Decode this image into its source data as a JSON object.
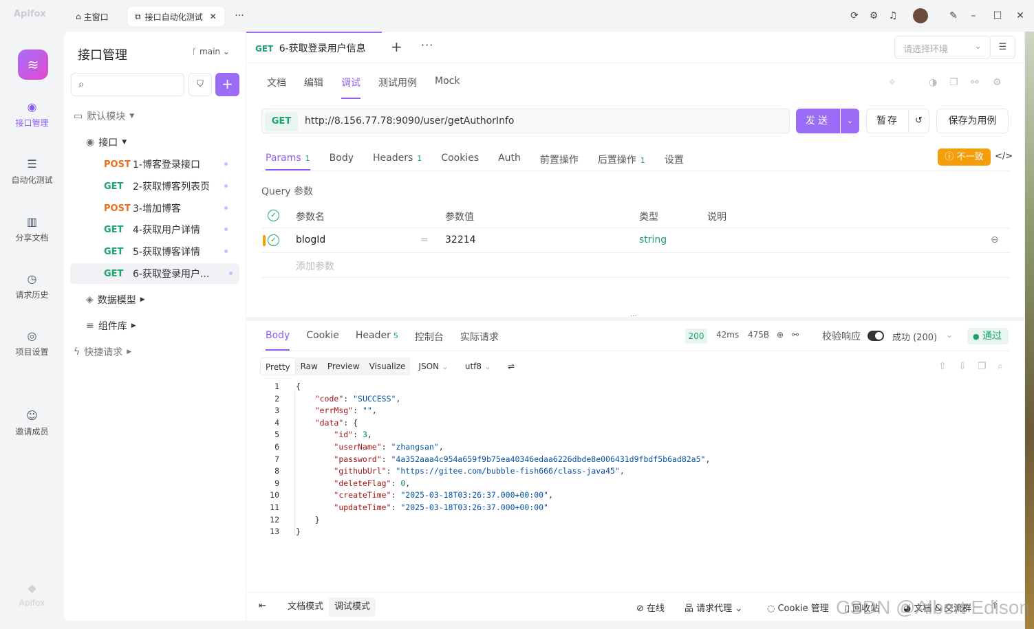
{
  "titlebar": {
    "app_name": "Apifox",
    "tabs": [
      {
        "label": "主窗口"
      },
      {
        "label": "接口自动化测试"
      }
    ],
    "more": "···"
  },
  "rail": {
    "items": [
      {
        "label": "接口管理",
        "icon": "api-icon"
      },
      {
        "label": "自动化测试",
        "icon": "automation-icon"
      },
      {
        "label": "分享文档",
        "icon": "book-icon"
      },
      {
        "label": "请求历史",
        "icon": "clock-icon"
      },
      {
        "label": "项目设置",
        "icon": "settings-icon"
      },
      {
        "label": "邀请成员",
        "icon": "user-add-icon"
      }
    ],
    "bottom_logo": "Apifox"
  },
  "sidebar": {
    "title": "接口管理",
    "branch": "main",
    "default_module": "默认模块",
    "folder": "接口",
    "endpoints": [
      {
        "method": "POST",
        "name": "1-博客登录接口"
      },
      {
        "method": "GET",
        "name": "2-获取博客列表页"
      },
      {
        "method": "POST",
        "name": "3-增加博客"
      },
      {
        "method": "GET",
        "name": "4-获取用户详情"
      },
      {
        "method": "GET",
        "name": "5-获取博客详情"
      },
      {
        "method": "GET",
        "name": "6-获取登录用户..."
      }
    ],
    "data_model": "数据模型",
    "components": "组件库",
    "quick_request": "快捷请求"
  },
  "request_tab": {
    "method": "GET",
    "name": "6-获取登录用户信息"
  },
  "env": {
    "placeholder": "请选择环境"
  },
  "subtabs": [
    "文档",
    "编辑",
    "调试",
    "测试用例",
    "Mock"
  ],
  "url_bar": {
    "method": "GET",
    "url": "http://8.156.77.78:9090/user/getAuthorInfo",
    "send": "发送",
    "save": "暂存",
    "save_case": "保存为用例"
  },
  "param_tabs": [
    {
      "label": "Params",
      "count": "1"
    },
    {
      "label": "Body",
      "count": ""
    },
    {
      "label": "Headers",
      "count": "1"
    },
    {
      "label": "Cookies",
      "count": ""
    },
    {
      "label": "Auth",
      "count": ""
    },
    {
      "label": "前置操作",
      "count": ""
    },
    {
      "label": "后置操作",
      "count": "1"
    },
    {
      "label": "设置",
      "count": ""
    }
  ],
  "diff_badge": "不一致",
  "query": {
    "label": "Query 参数",
    "headers": {
      "name": "参数名",
      "value": "参数值",
      "type": "类型",
      "desc": "说明"
    },
    "row": {
      "name": "blogId",
      "eq": "=",
      "value": "32214",
      "type": "string"
    },
    "add_placeholder": "添加参数"
  },
  "response": {
    "tabs": [
      {
        "label": "Body",
        "count": ""
      },
      {
        "label": "Cookie",
        "count": ""
      },
      {
        "label": "Header",
        "count": "5"
      },
      {
        "label": "控制台",
        "count": ""
      },
      {
        "label": "实际请求",
        "count": ""
      }
    ],
    "status": "200",
    "time": "42ms",
    "size": "475B",
    "validate_label": "校验响应",
    "result": "成功 (200)",
    "pass": "通过",
    "formats": [
      "Pretty",
      "Raw",
      "Preview",
      "Visualize"
    ],
    "lang": "JSON",
    "encoding": "utf8",
    "lines": [
      "{",
      "    \"code\": \"SUCCESS\",",
      "    \"errMsg\": \"\",",
      "    \"data\": {",
      "        \"id\": 3,",
      "        \"userName\": \"zhangsan\",",
      "        \"password\": \"4a352aaa4c954a659f9b75ea40346edaa6226dbde8e006431d9fbdf5b6ad82a5\",",
      "        \"githubUrl\": \"https://gitee.com/bubble-fish666/class-java45\",",
      "        \"deleteFlag\": 0,",
      "        \"createTime\": \"2025-03-18T03:26:37.000+00:00\",",
      "        \"updateTime\": \"2025-03-18T03:26:37.000+00:00\"",
      "    }",
      "}"
    ]
  },
  "footer": {
    "doc_mode": "文档模式",
    "debug_mode": "调试模式",
    "online": "在线",
    "proxy": "请求代理",
    "cookie": "Cookie 管理",
    "recycle": "回收站",
    "community": "文档 & 交流群"
  },
  "watermark": "CSDN @Albert Edison"
}
